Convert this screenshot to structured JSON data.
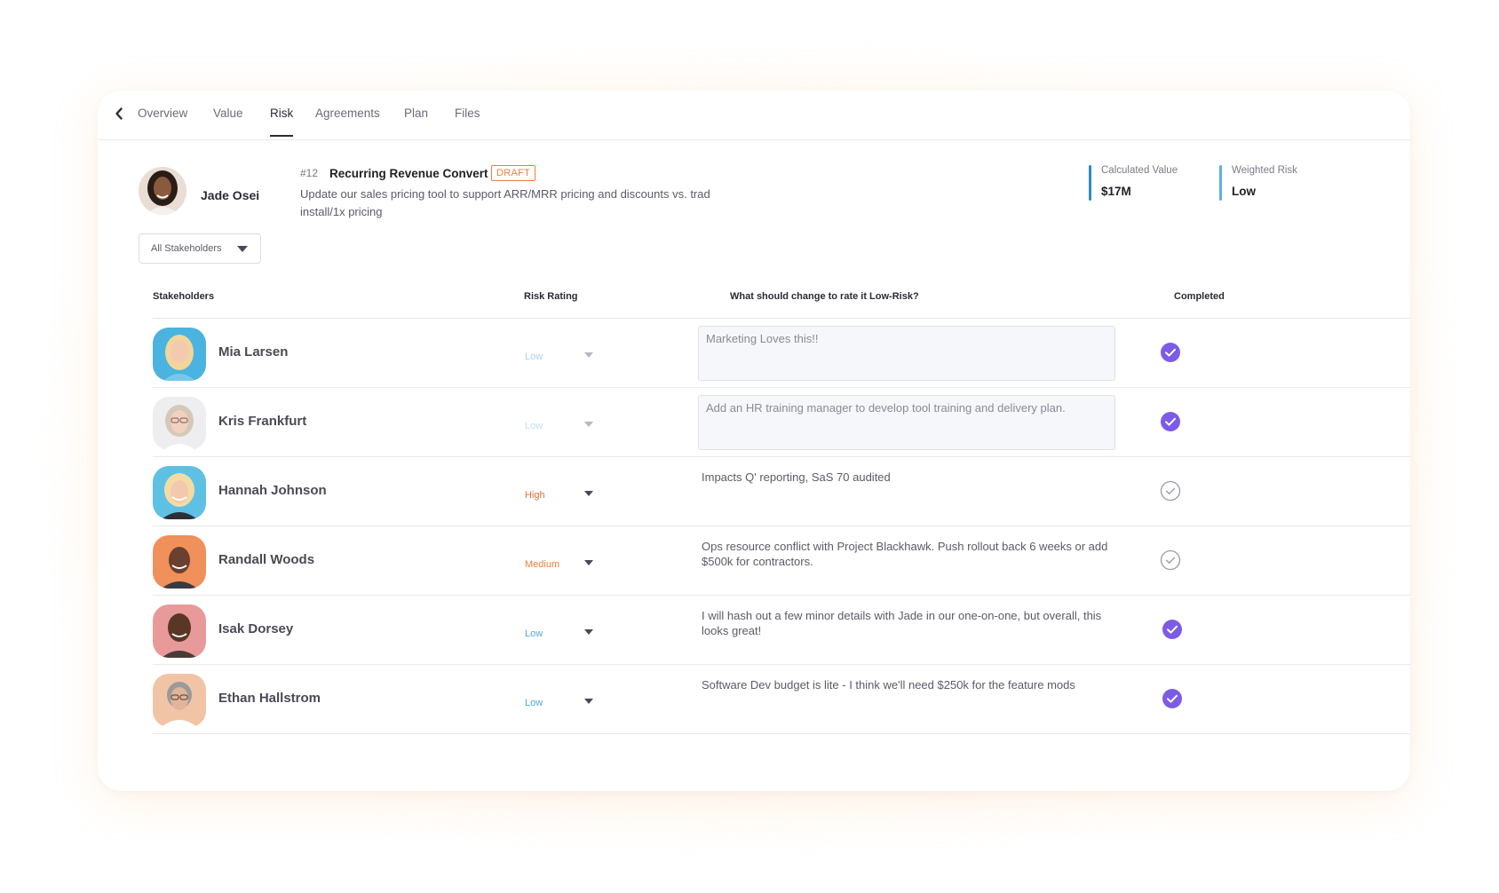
{
  "tabs": [
    {
      "label": "Overview"
    },
    {
      "label": "Value"
    },
    {
      "label": "Risk",
      "active": true
    },
    {
      "label": "Agreements"
    },
    {
      "label": "Plan"
    },
    {
      "label": "Files"
    }
  ],
  "project": {
    "owner_name": "Jade Osei",
    "number": "#12",
    "title": "Recurring Revenue Convert",
    "status": "DRAFT",
    "description": "Update our sales pricing tool to support ARR/MRR pricing and discounts vs. trad install/1x pricing"
  },
  "metrics": {
    "calculated_value_label": "Calculated Value",
    "calculated_value": "$17M",
    "weighted_risk_label": "Weighted Risk",
    "weighted_risk": "Low"
  },
  "filter": {
    "selected": "All Stakeholders"
  },
  "table": {
    "headers": {
      "stakeholders": "Stakeholders",
      "risk_rating": "Risk Rating",
      "change": "What should change to rate it Low-Risk?",
      "completed": "Completed"
    },
    "rows": [
      {
        "name": "Mia Larsen",
        "rating": "Low",
        "note": "Marketing Loves this!!",
        "completed": true
      },
      {
        "name": "Kris Frankfurt",
        "rating": "Low",
        "note": "Add an HR training manager to develop tool training and delivery plan.",
        "completed": true
      },
      {
        "name": "Hannah Johnson",
        "rating": "High",
        "note": "Impacts Q' reporting, SaS 70 audited",
        "completed": false
      },
      {
        "name": "Randall Woods",
        "rating": "Medium",
        "note": "Ops resource conflict with Project Blackhawk. Push rollout back 6 weeks or add $500k for contractors.",
        "completed": false
      },
      {
        "name": "Isak Dorsey",
        "rating": "Low",
        "note": "I will hash out a few minor details with Jade in our one-on-one, but overall, this looks great!",
        "completed": true
      },
      {
        "name": "Ethan Hallstrom",
        "rating": "Low",
        "note": "Software Dev budget is lite - I think we'll need $250k for the feature mods",
        "completed": true
      }
    ]
  },
  "colors": {
    "accent_purple": "#7c5ce6",
    "low": "#4fa8e0",
    "low_dim": "#a9d3f0",
    "high": "#ef6b3c",
    "medium": "#ef7d3a",
    "metric_bar_value": "#2b8cc4",
    "metric_bar_risk": "#5ab0e4"
  }
}
